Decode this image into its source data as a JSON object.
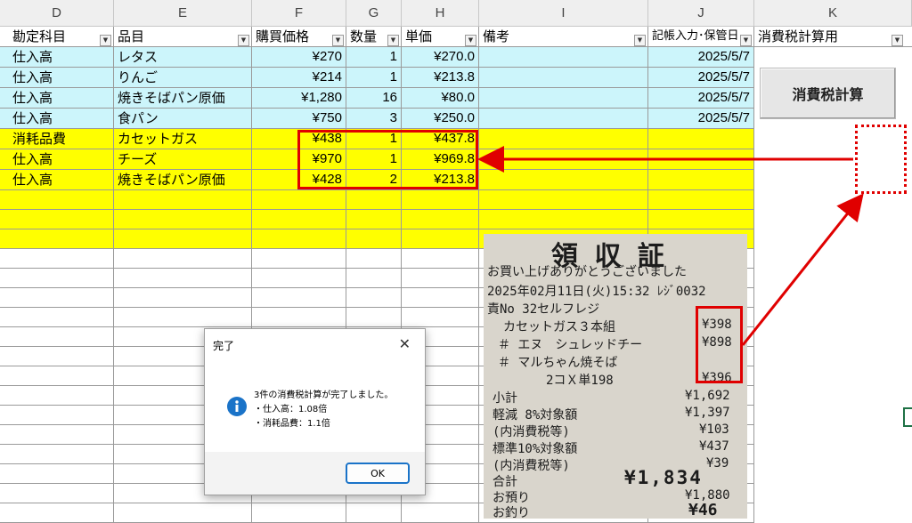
{
  "columns": [
    "D",
    "E",
    "F",
    "G",
    "H",
    "I",
    "J",
    "K"
  ],
  "headers": {
    "d": "勘定科目",
    "e": "品目",
    "f": "購買価格",
    "g": "数量",
    "h": "単価",
    "i": "備考",
    "j": "記帳入力･保管日",
    "k": "消費税計算用"
  },
  "rows": [
    {
      "account": "仕入高",
      "item": "レタス",
      "price": "¥270",
      "qty": "1",
      "unit": "¥270.0",
      "note": "",
      "date": "2025/5/7"
    },
    {
      "account": "仕入高",
      "item": "りんご",
      "price": "¥214",
      "qty": "1",
      "unit": "¥213.8",
      "note": "",
      "date": "2025/5/7"
    },
    {
      "account": "仕入高",
      "item": "焼きそばパン原価",
      "price": "¥1,280",
      "qty": "16",
      "unit": "¥80.0",
      "note": "",
      "date": "2025/5/7"
    },
    {
      "account": "仕入高",
      "item": "食パン",
      "price": "¥750",
      "qty": "3",
      "unit": "¥250.0",
      "note": "",
      "date": "2025/5/7"
    },
    {
      "account": "消耗品費",
      "item": "カセットガス",
      "price": "¥438",
      "qty": "1",
      "unit": "¥437.8",
      "note": "",
      "date": ""
    },
    {
      "account": "仕入高",
      "item": "チーズ",
      "price": "¥970",
      "qty": "1",
      "unit": "¥969.8",
      "note": "",
      "date": ""
    },
    {
      "account": "仕入高",
      "item": "焼きそばパン原価",
      "price": "¥428",
      "qty": "2",
      "unit": "¥213.8",
      "note": "",
      "date": ""
    }
  ],
  "button": {
    "label": "消費税計算"
  },
  "receipt": {
    "title": "領 収 証",
    "thanks": "お買い上げありがとうございました",
    "datetime": "2025年02月11日(火)15:32 ﾚｼﾞ0032",
    "register": "責No      32セルフレジ",
    "items": [
      {
        "name": "カセットガス３本組",
        "price": "¥398"
      },
      {
        "name": "＃ エヌ　シュレッドチー",
        "price": "¥898"
      },
      {
        "name": "＃ マルちゃん焼そば",
        "price": ""
      },
      {
        "name": "　　2コＸ単198",
        "price": "¥396"
      }
    ],
    "summary": [
      {
        "label": "小計",
        "value": "¥1,692"
      },
      {
        "label": "軽減 8%対象額",
        "value": "¥1,397"
      },
      {
        "label": "(内消費税等)",
        "value": "¥103"
      },
      {
        "label": "標準10%対象額",
        "value": "¥437"
      },
      {
        "label": "(内消費税等)",
        "value": "¥39"
      }
    ],
    "total_label": "合計",
    "total_value": "¥1,834",
    "received_label": "お預り",
    "received_value": "¥1,880",
    "change_label": "お釣り",
    "change_value": "¥46"
  },
  "dialog": {
    "title": "完了",
    "message": "3件の消費税計算が完了しました。",
    "line1": "・仕入高：1.08倍",
    "line2": "・消耗品費：1.1倍",
    "ok": "OK"
  },
  "colors": {
    "blue_fill": "#ccf5fb",
    "yellow_fill": "#ffff00",
    "annotation_red": "#e00000",
    "info_blue": "#1a73c8"
  }
}
